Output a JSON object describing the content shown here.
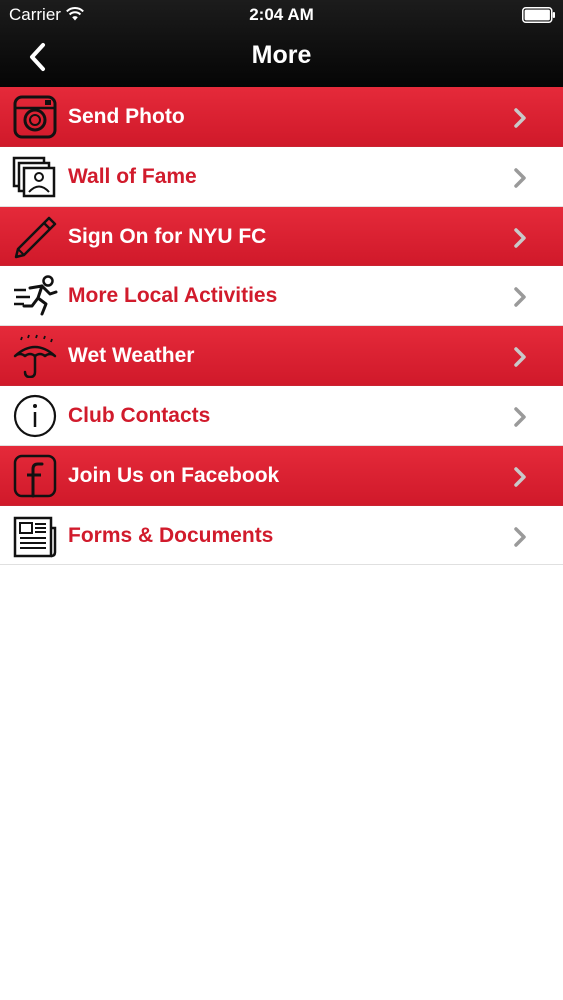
{
  "status_bar": {
    "carrier": "Carrier",
    "time": "2:04 AM"
  },
  "nav": {
    "title": "More",
    "back_icon": "chevron-left-icon"
  },
  "colors": {
    "brand_red": "#d8202f",
    "label_red": "#d11b2c",
    "header_black": "#111111",
    "chevron_gray": "#9a9a9a"
  },
  "menu": {
    "items": [
      {
        "label": "Send Photo",
        "icon": "camera-icon",
        "style": "red"
      },
      {
        "label": "Wall of Fame",
        "icon": "photos-icon",
        "style": "white"
      },
      {
        "label": "Sign On for NYU FC",
        "icon": "pencil-icon",
        "style": "red"
      },
      {
        "label": "More Local Activities",
        "icon": "running-person-icon",
        "style": "white"
      },
      {
        "label": "Wet Weather",
        "icon": "umbrella-icon",
        "style": "red"
      },
      {
        "label": "Club Contacts",
        "icon": "info-icon",
        "style": "white"
      },
      {
        "label": "Join Us on Facebook",
        "icon": "facebook-icon",
        "style": "red"
      },
      {
        "label": "Forms & Documents",
        "icon": "newspaper-icon",
        "style": "white"
      }
    ]
  }
}
